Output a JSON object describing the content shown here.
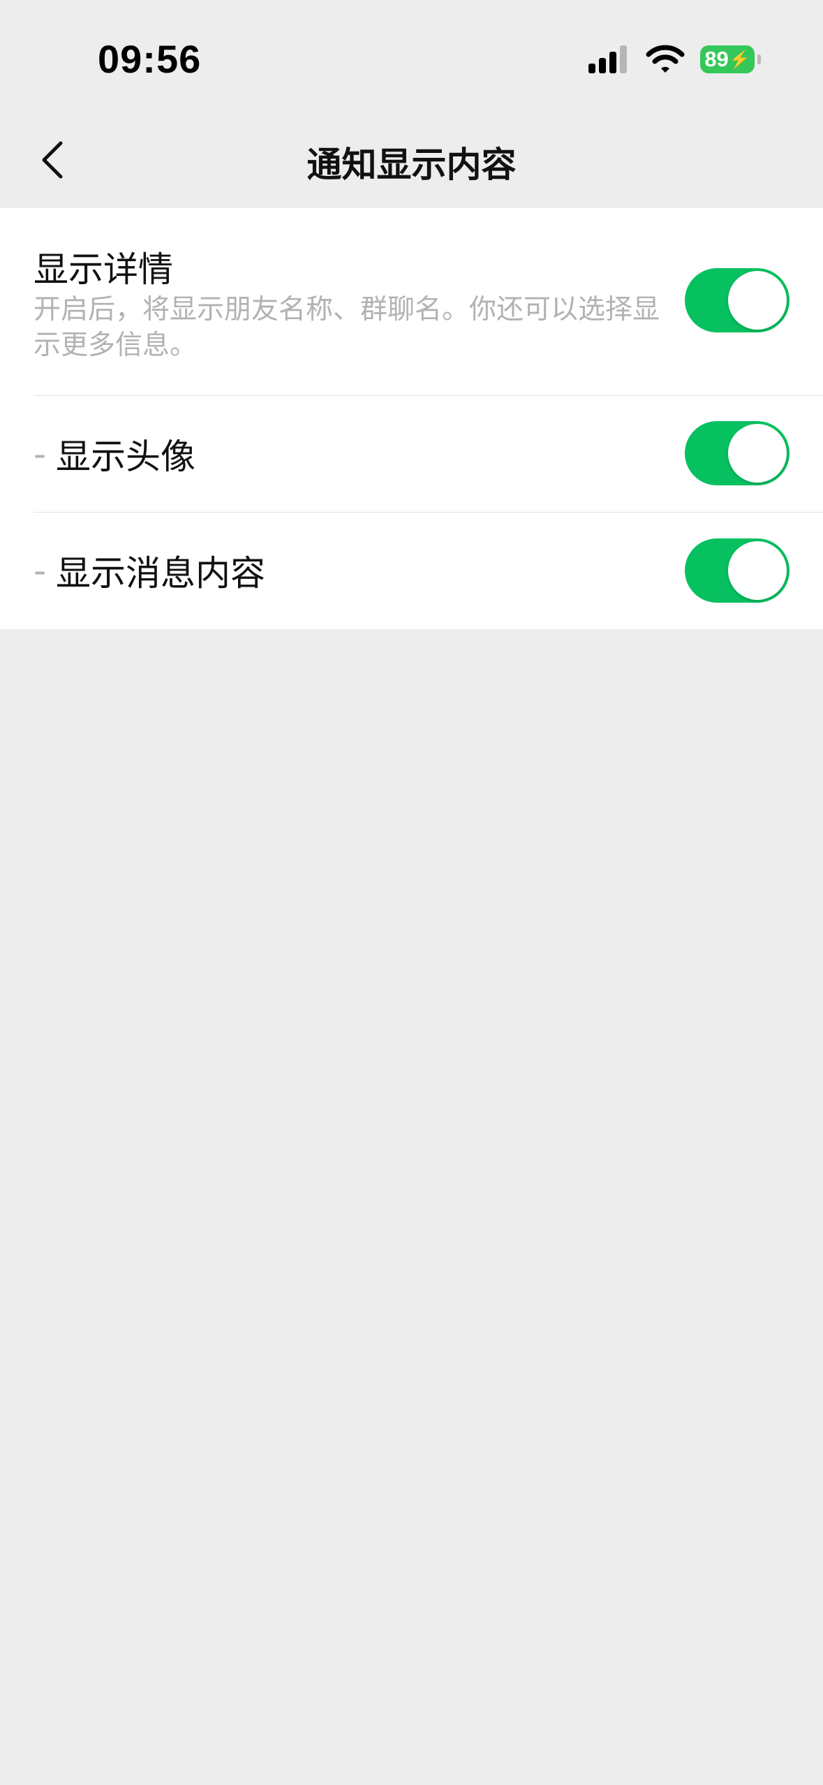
{
  "status_bar": {
    "time": "09:56",
    "battery": "89"
  },
  "nav": {
    "title": "通知显示内容",
    "back_icon": "chevron-left-icon"
  },
  "settings": {
    "show_details": {
      "label": "显示详情",
      "description": "开启后，将显示朋友名称、群聊名。你还可以选择显示更多信息。",
      "enabled": true
    },
    "show_avatar": {
      "prefix": "-",
      "label": "显示头像",
      "enabled": true
    },
    "show_message_content": {
      "prefix": "-",
      "label": "显示消息内容",
      "enabled": true
    }
  },
  "colors": {
    "toggle_on": "#07c160",
    "background": "#ededed",
    "battery": "#34c759",
    "secondary_text": "#b2b2b2"
  }
}
